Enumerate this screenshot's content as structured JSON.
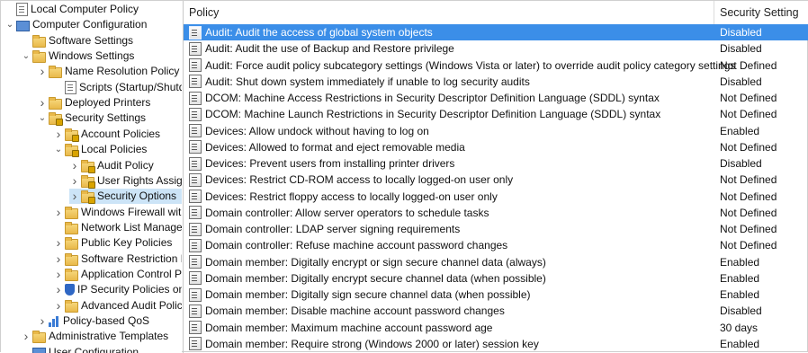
{
  "tree": {
    "items": [
      {
        "label": "Local Computer Policy",
        "icon": "document-icon",
        "chev": ""
      },
      {
        "label": "Computer Configuration",
        "icon": "computer-icon",
        "chev": "v"
      },
      {
        "label": "Software Settings",
        "icon": "folder-icon",
        "chev": ""
      },
      {
        "label": "Windows Settings",
        "icon": "folder-icon",
        "chev": "v"
      },
      {
        "label": "Name Resolution Policy",
        "icon": "folder-icon",
        "chev": ">"
      },
      {
        "label": "Scripts (Startup/Shutdown)",
        "icon": "document-icon",
        "chev": ""
      },
      {
        "label": "Deployed Printers",
        "icon": "folder-icon",
        "chev": ">"
      },
      {
        "label": "Security Settings",
        "icon": "folder-lock-icon",
        "chev": "v"
      },
      {
        "label": "Account Policies",
        "icon": "folder-lock-icon",
        "chev": ">"
      },
      {
        "label": "Local Policies",
        "icon": "folder-lock-icon",
        "chev": "v"
      },
      {
        "label": "Audit Policy",
        "icon": "folder-lock-icon",
        "chev": ">"
      },
      {
        "label": "User Rights Assignment",
        "icon": "folder-lock-icon",
        "chev": ">"
      },
      {
        "label": "Security Options",
        "icon": "folder-lock-icon",
        "chev": ">"
      },
      {
        "label": "Windows Firewall with Advanced Security",
        "icon": "folder-icon",
        "chev": ">"
      },
      {
        "label": "Network List Manager Policies",
        "icon": "folder-icon",
        "chev": ""
      },
      {
        "label": "Public Key Policies",
        "icon": "folder-icon",
        "chev": ">"
      },
      {
        "label": "Software Restriction Policies",
        "icon": "folder-icon",
        "chev": ">"
      },
      {
        "label": "Application Control Policies",
        "icon": "folder-icon",
        "chev": ">"
      },
      {
        "label": "IP Security Policies on Local Computer",
        "icon": "shield-icon",
        "chev": ">"
      },
      {
        "label": "Advanced Audit Policy Configuration",
        "icon": "folder-icon",
        "chev": ">"
      },
      {
        "label": "Policy-based QoS",
        "icon": "chart-icon",
        "chev": ">"
      },
      {
        "label": "Administrative Templates",
        "icon": "folder-icon",
        "chev": ">"
      },
      {
        "label": "User Configuration",
        "icon": "computer-icon",
        "chev": ""
      }
    ]
  },
  "list": {
    "headers": {
      "policy": "Policy",
      "setting": "Security Setting"
    },
    "rows": [
      {
        "policy": "Audit: Audit the access of global system objects",
        "setting": "Disabled"
      },
      {
        "policy": "Audit: Audit the use of Backup and Restore privilege",
        "setting": "Disabled"
      },
      {
        "policy": "Audit: Force audit policy subcategory settings (Windows Vista or later) to override audit policy category settings",
        "setting": "Not Defined"
      },
      {
        "policy": "Audit: Shut down system immediately if unable to log security audits",
        "setting": "Disabled"
      },
      {
        "policy": "DCOM: Machine Access Restrictions in Security Descriptor Definition Language (SDDL) syntax",
        "setting": "Not Defined"
      },
      {
        "policy": "DCOM: Machine Launch Restrictions in Security Descriptor Definition Language (SDDL) syntax",
        "setting": "Not Defined"
      },
      {
        "policy": "Devices: Allow undock without having to log on",
        "setting": "Enabled"
      },
      {
        "policy": "Devices: Allowed to format and eject removable media",
        "setting": "Not Defined"
      },
      {
        "policy": "Devices: Prevent users from installing printer drivers",
        "setting": "Disabled"
      },
      {
        "policy": "Devices: Restrict CD-ROM access to locally logged-on user only",
        "setting": "Not Defined"
      },
      {
        "policy": "Devices: Restrict floppy access to locally logged-on user only",
        "setting": "Not Defined"
      },
      {
        "policy": "Domain controller: Allow server operators to schedule tasks",
        "setting": "Not Defined"
      },
      {
        "policy": "Domain controller: LDAP server signing requirements",
        "setting": "Not Defined"
      },
      {
        "policy": "Domain controller: Refuse machine account password changes",
        "setting": "Not Defined"
      },
      {
        "policy": "Domain member: Digitally encrypt or sign secure channel data (always)",
        "setting": "Enabled"
      },
      {
        "policy": "Domain member: Digitally encrypt secure channel data (when possible)",
        "setting": "Enabled"
      },
      {
        "policy": "Domain member: Digitally sign secure channel data (when possible)",
        "setting": "Enabled"
      },
      {
        "policy": "Domain member: Disable machine account password changes",
        "setting": "Disabled"
      },
      {
        "policy": "Domain member: Maximum machine account password age",
        "setting": "30 days"
      },
      {
        "policy": "Domain member: Require strong (Windows 2000 or later) session key",
        "setting": "Enabled"
      }
    ]
  }
}
